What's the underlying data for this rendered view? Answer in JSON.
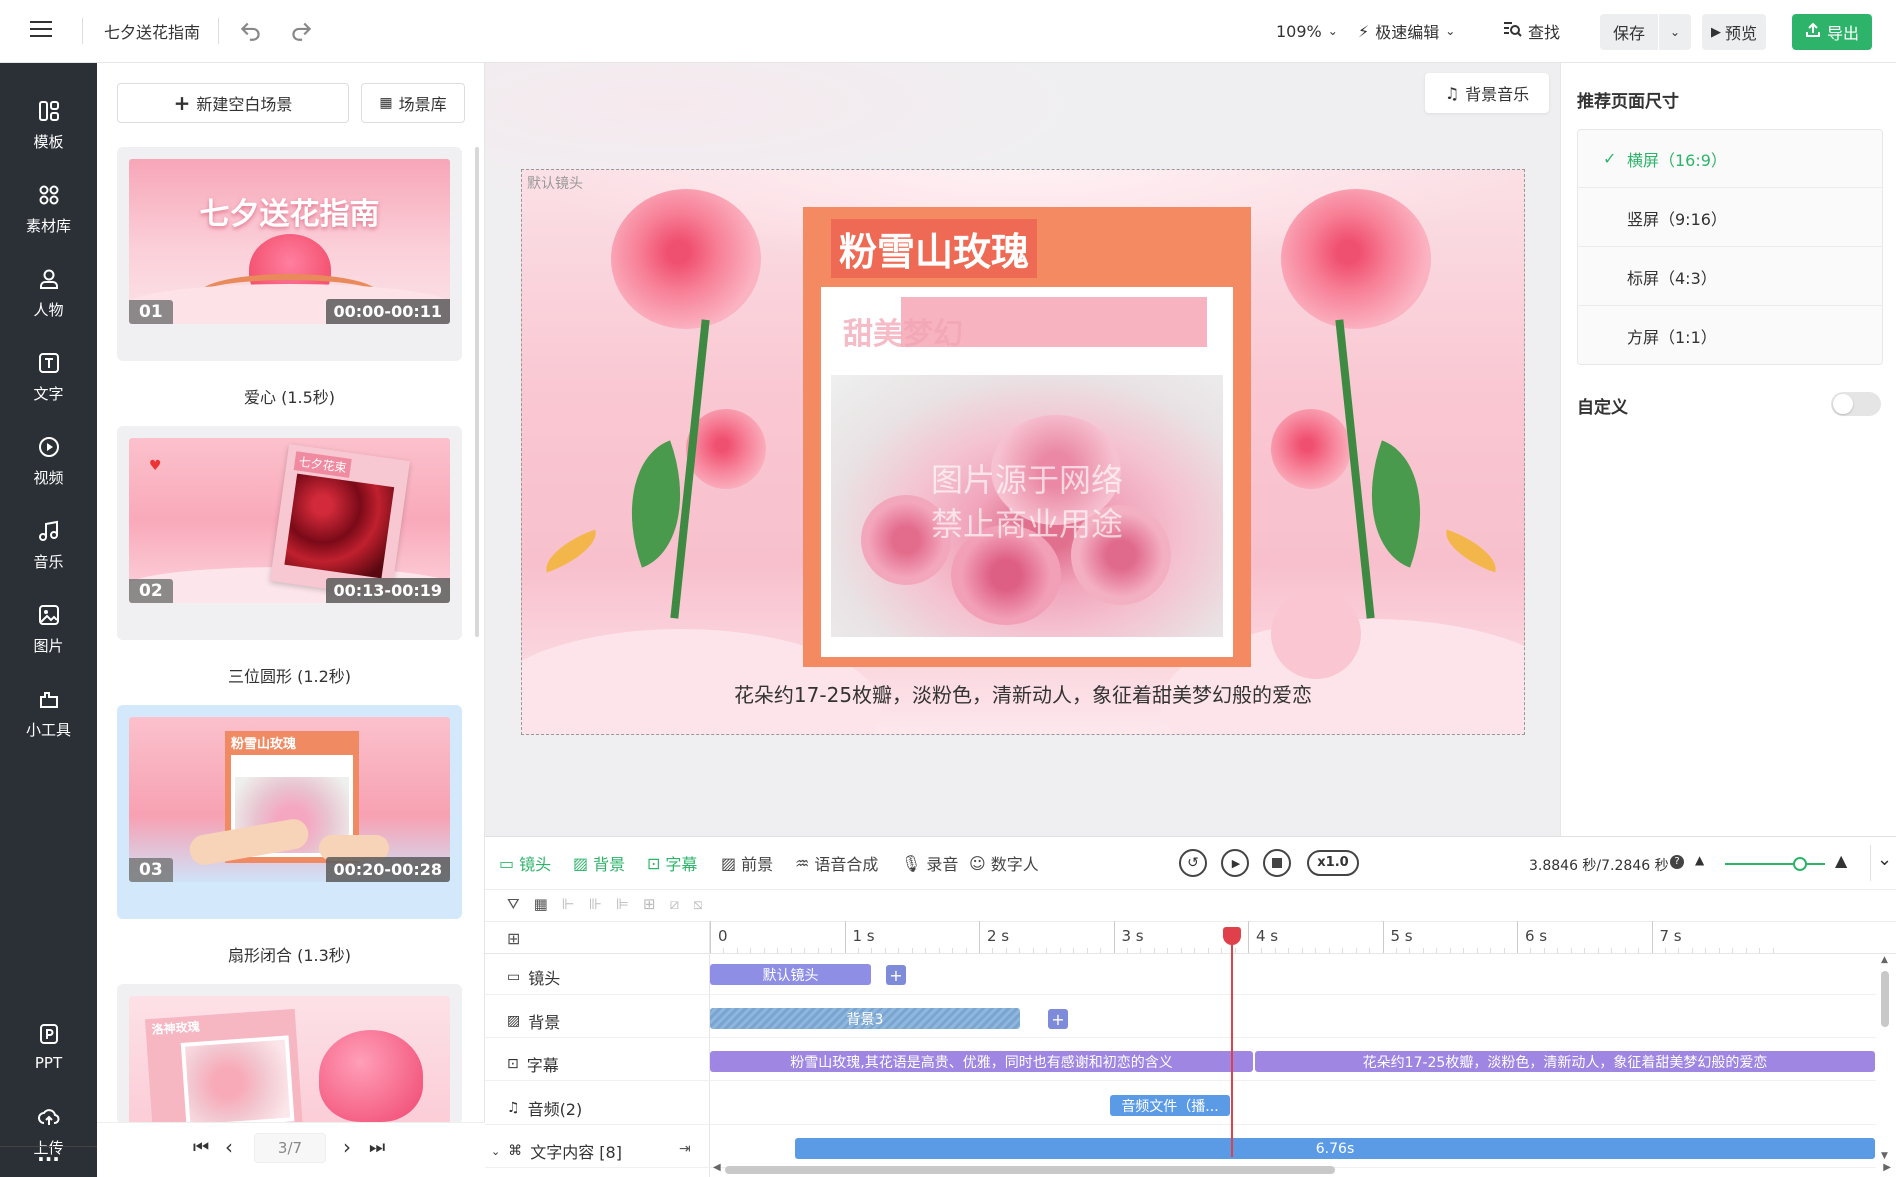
{
  "header": {
    "menu_icon": "hamburger-icon",
    "project_title": "七夕送花指南",
    "zoom": "109%",
    "edit_mode": "极速编辑",
    "search_label": "查找",
    "save_label": "保存",
    "preview_label": "预览",
    "export_label": "导出"
  },
  "sidebar": {
    "items": [
      {
        "label": "模板",
        "icon": "template-icon"
      },
      {
        "label": "素材库",
        "icon": "material-icon"
      },
      {
        "label": "人物",
        "icon": "person-icon"
      },
      {
        "label": "文字",
        "icon": "text-icon"
      },
      {
        "label": "视频",
        "icon": "video-icon"
      },
      {
        "label": "音乐",
        "icon": "music-icon"
      },
      {
        "label": "图片",
        "icon": "image-icon"
      },
      {
        "label": "小工具",
        "icon": "tool-icon"
      }
    ],
    "bottom": [
      {
        "label": "PPT",
        "icon": "ppt-icon"
      },
      {
        "label": "上传",
        "icon": "upload-icon"
      }
    ],
    "more": "···"
  },
  "scenes": {
    "new_blank_label": "新建空白场景",
    "library_label": "场景库",
    "cards": [
      {
        "num": "01",
        "time": "00:00-00:11",
        "label": "爱心 (1.5秒)",
        "thumb_title": "七夕送花指南"
      },
      {
        "num": "02",
        "time": "00:13-00:19",
        "label": "三位圆形 (1.2秒)",
        "thumb_title": "七夕花束"
      },
      {
        "num": "03",
        "time": "00:20-00:28",
        "label": "扇形闭合 (1.3秒)",
        "thumb_title": "粉雪山玫瑰"
      },
      {
        "thumb_title": "洛神玫瑰"
      }
    ],
    "pager": {
      "current": "3/7"
    }
  },
  "canvas": {
    "bg_music_label": "背景音乐",
    "lens_label": "默认镜头",
    "card_title": "粉雪山玫瑰",
    "card_subtitle": "甜美梦幻",
    "watermark_1": "图片源于网络",
    "watermark_2": "禁止商业用途",
    "caption": "花朵约17-25枚瓣，淡粉色，清新动人，象征着甜美梦幻般的爱恋"
  },
  "right_panel": {
    "title": "推荐页面尺寸",
    "ratios": [
      "横屏（16:9）",
      "竖屏（9:16）",
      "标屏（4:3）",
      "方屏（1:1）"
    ],
    "selected_index": 0,
    "custom_label": "自定义",
    "custom_enabled": false
  },
  "timeline": {
    "tools": [
      "镜头",
      "背景",
      "字幕",
      "前景",
      "语音合成",
      "录音",
      "数字人"
    ],
    "speed": "x1.0",
    "time_readout": "3.8846 秒/7.2846 秒",
    "zoom_level": 0.75,
    "ruler": [
      "0",
      "1 s",
      "2 s",
      "3 s",
      "4 s",
      "5 s",
      "6 s",
      "7 s"
    ],
    "playhead_seconds": 3.8846,
    "tracks": [
      {
        "label": "镜头",
        "icon": "camera-icon"
      },
      {
        "label": "背景",
        "icon": "background-icon"
      },
      {
        "label": "字幕",
        "icon": "subtitle-icon"
      },
      {
        "label": "音频(2)",
        "icon": "audio-icon"
      },
      {
        "label": "文字内容 [8]",
        "icon": "text-content-icon"
      }
    ],
    "clips": {
      "lens": "默认镜头",
      "background": "背景3",
      "subtitle_1": "粉雪山玫瑰,其花语是高贵、优雅，同时也有感谢和初恋的含义",
      "subtitle_2": "花朵约17-25枚瓣，淡粉色，清新动人，象征着甜美梦幻般的爱恋",
      "audio": "音频文件（播...",
      "text_content": "6.76s"
    }
  },
  "colors": {
    "accent_green": "#2db46a",
    "sidebar_bg": "#2b2f36",
    "clip_purple": "#9f86e3",
    "clip_blue": "#5b9be6",
    "playhead_red": "#e0404a"
  }
}
